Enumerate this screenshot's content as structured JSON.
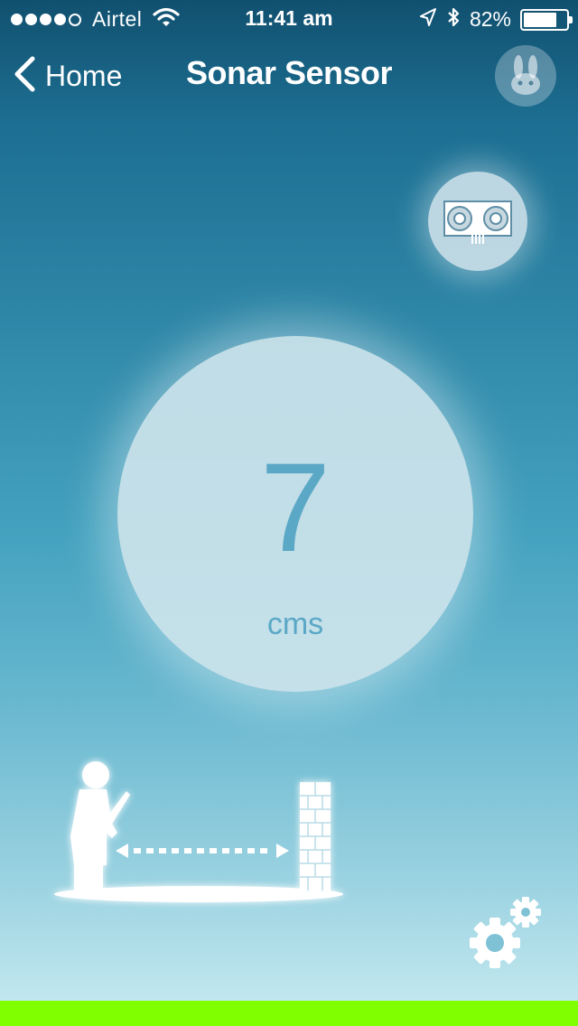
{
  "status_bar": {
    "signal_dots_filled": 4,
    "signal_dots_total": 5,
    "carrier": "Airtel",
    "time": "11:41 am",
    "battery_percent_text": "82%",
    "battery_level": 0.82,
    "icons": [
      "wifi-icon",
      "location-arrow-icon",
      "bluetooth-icon",
      "battery-icon"
    ]
  },
  "nav": {
    "back_label": "Home",
    "title": "Sonar Sensor",
    "right_icon": "rabbit-icon"
  },
  "sensor": {
    "icon": "ultrasonic-sensor-icon",
    "value": "7",
    "unit": "cms"
  },
  "illustration": {
    "icons": [
      "person-icon",
      "distance-arrow-icon",
      "brick-wall-icon"
    ]
  },
  "footer": {
    "settings_icon": "gears-icon",
    "bar_color": "#7fff00"
  }
}
